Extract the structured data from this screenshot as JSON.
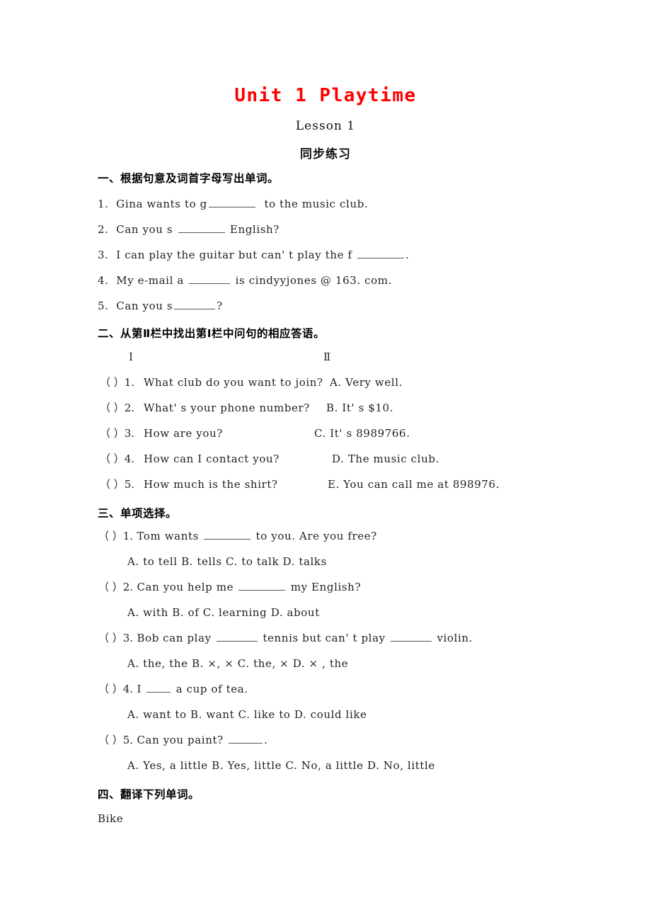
{
  "document": {
    "title": "Unit 1 Playtime",
    "lesson": "Lesson 1",
    "practice_label": "同步练习",
    "title_color": "#ff0000"
  },
  "section1": {
    "heading": "一、根据句意及词首字母写出单词。",
    "items": [
      {
        "num": "1.",
        "before": "Gina wants to g",
        "after": "to the music club."
      },
      {
        "num": "2.",
        "before": "Can you s",
        "after": "English?"
      },
      {
        "num": "3.",
        "before": "I can play the guitar but can' t play the f",
        "after": "."
      },
      {
        "num": "4.",
        "before": "My e-mail a",
        "after": "is cindyyjones @ 163. com."
      },
      {
        "num": "5.",
        "before": "Can you s",
        "after": "?"
      }
    ]
  },
  "section2": {
    "heading": "二、从第Ⅱ栏中找出第Ⅰ栏中问句的相应答语。",
    "column1_head": "Ⅰ",
    "column2_head": "Ⅱ",
    "rows": [
      {
        "marker": "（ ）1.",
        "question": "What club do you want to join?",
        "answer": "A. Very well."
      },
      {
        "marker": "（ ）2.",
        "question": "What' s your phone number?",
        "answer": "B. It' s $10."
      },
      {
        "marker": "（ ）3.",
        "question": "How are you?",
        "answer": "C. It' s 8989766."
      },
      {
        "marker": "（ ）4.",
        "question": "How can I contact you?",
        "answer": "D. The music club."
      },
      {
        "marker": "（ ）5.",
        "question": "How much is the shirt?",
        "answer": "E. You can call me at 898976."
      }
    ]
  },
  "section3": {
    "heading": "三、单项选择。",
    "items": [
      {
        "marker": "（  ）1.",
        "stem_before": "Tom wants",
        "stem_after": "to you. Are you free?",
        "options": "A. to tell  B. tells  C. to talk  D. talks"
      },
      {
        "marker": "（  ）2.",
        "stem_before": "Can you help me",
        "stem_after": "my English?",
        "options": "A. with  B. of  C. learning  D. about"
      },
      {
        "marker": "（  ）3.",
        "stem_before": "Bob can play",
        "stem_mid": "tennis but can' t play",
        "stem_after": "violin.",
        "options": "A. the, the  B. ×, ×  C. the, ×  D. × , the"
      },
      {
        "marker": "（  ）4.",
        "stem_before": "I",
        "stem_after": "a cup of tea.",
        "options": "A. want to  B. want  C. like to  D. could like"
      },
      {
        "marker": "（  ）5.",
        "stem_before": "Can you paint?",
        "stem_after": ".",
        "options": "A. Yes, a little  B. Yes, little  C. No, a little  D. No, little"
      }
    ]
  },
  "section4": {
    "heading": "四、翻译下列单词。",
    "words": [
      "Bike"
    ]
  }
}
